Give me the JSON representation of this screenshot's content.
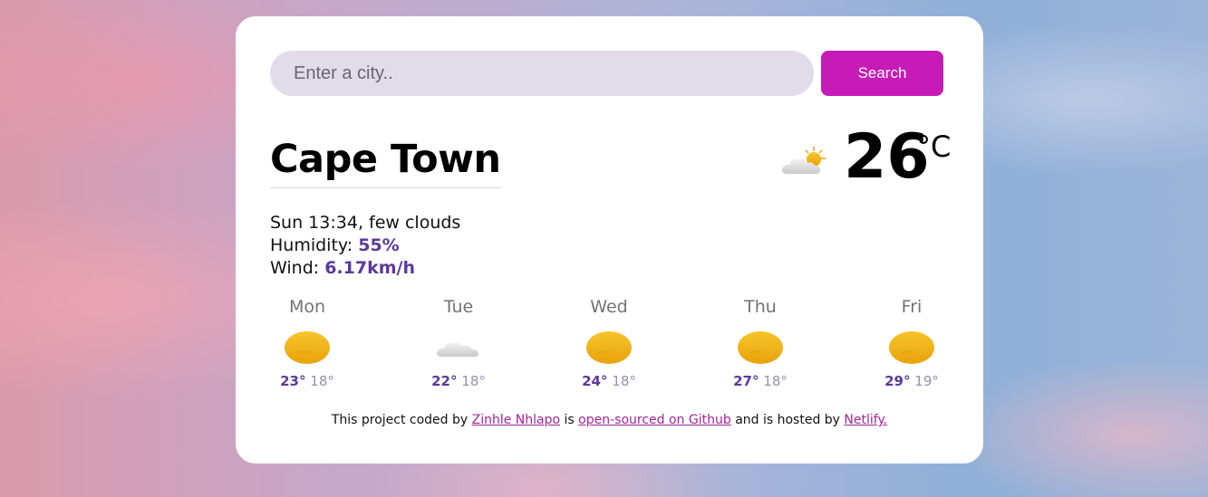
{
  "search": {
    "placeholder": "Enter a city..",
    "button_label": "Search"
  },
  "current": {
    "city": "Cape Town",
    "datetime_desc": "Sun 13:34, few clouds",
    "humidity_label": "Humidity: ",
    "humidity_value": "55%",
    "wind_label": "Wind: ",
    "wind_value": "6.17km/h",
    "icon": "few-clouds-icon",
    "temperature": "26",
    "unit": "°C"
  },
  "forecast": [
    {
      "day": "Mon",
      "icon": "sun-icon",
      "max": "23°",
      "min": "18°"
    },
    {
      "day": "Tue",
      "icon": "cloud-icon",
      "max": "22°",
      "min": "18°"
    },
    {
      "day": "Wed",
      "icon": "sun-icon",
      "max": "24°",
      "min": "18°"
    },
    {
      "day": "Thu",
      "icon": "sun-icon",
      "max": "27°",
      "min": "18°"
    },
    {
      "day": "Fri",
      "icon": "sun-icon",
      "max": "29°",
      "min": "19°"
    }
  ],
  "footer": {
    "text1": "This project coded by ",
    "author_link": "Zinhle Nhlapo",
    "text2": " is ",
    "github_link": "open-sourced on Github",
    "text3": " and is hosted by ",
    "netlify_link": "Netlify."
  },
  "colors": {
    "accent": "#c71bb8",
    "value": "#5b3a9a",
    "input_bg": "#e2dbe9"
  }
}
